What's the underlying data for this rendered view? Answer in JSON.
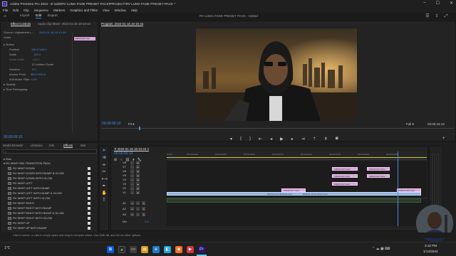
{
  "window": {
    "title": "Adobe Premiere Pro 2024 - E:\\utils\\RV LUMA FADE PRESET PACK\\PROJECT\\RV LUMA FADE PRESET PACK *",
    "app_icon": "Pr"
  },
  "menu": [
    "File",
    "Edit",
    "Clip",
    "Sequence",
    "Markers",
    "Graphics and Titles",
    "View",
    "Window",
    "Help"
  ],
  "workspace": {
    "tabs": [
      "Import",
      "Edit",
      "Export"
    ],
    "active_tab": "Edit",
    "center_title": "RV LUMA FADE PRESET PACK - Edited"
  },
  "effect_controls": {
    "tabs": [
      "Effect Controls",
      "Audio Clip Mixer: 2024-01-16 19-10-44"
    ],
    "source_label": "Source • Adjustment L...",
    "seq_label": "2024-01-16 19-10-44",
    "clip_chip": "Adjustment Lay",
    "section_video": "Video",
    "rows": [
      {
        "label": "Motion",
        "value": ""
      },
      {
        "label": "Position",
        "value": "960.0   540.0"
      },
      {
        "label": "Scale",
        "value": "100.0"
      },
      {
        "label": "Scale Width",
        "value": "100.0"
      },
      {
        "label": "",
        "value": "Uniform Scale"
      },
      {
        "label": "Rotation",
        "value": "0.0"
      },
      {
        "label": "Anchor Point",
        "value": "960.0   540.0"
      },
      {
        "label": "Anti-flicker Filter",
        "value": "0.00"
      },
      {
        "label": "Opacity",
        "value": ""
      },
      {
        "label": "Time Remapping",
        "value": ""
      }
    ],
    "timecode": "00:00:09:10"
  },
  "program": {
    "title": "Program: 2024-01-16 19-10-44",
    "timecode": "00:00:09:10",
    "fit": "Fit",
    "quality": "Full",
    "duration": "00:00:44:18"
  },
  "project": {
    "tabs": [
      "Media Browser",
      "Libraries",
      "Info",
      "Effects",
      "Mar"
    ],
    "active_tab": "Effects",
    "folders": [
      "Bins",
      "RV WHIP PAN TRANSITION PACK"
    ],
    "items": [
      "RV WHIP DOWN",
      "RV WHIP DOWN WITH BUMP & GLOW",
      "RV WHIP DOWN WITH GLOW",
      "RV WHIP LEFT",
      "RV WHIP LEFT WITH BUMP",
      "RV WHIP LEFT WITH BUMP & GLOW",
      "RV WHIP LEFT WITH GLOW",
      "RV WHIP RIGHT",
      "RV WHIP RIGHT WITH BUMP",
      "RV WHIP RIGHT WITH BUMP & GLOW",
      "RV WHIP RIGHT WITH GLOW",
      "RV WHIP UP",
      "RV WHIP UP WITH BUMP"
    ]
  },
  "timeline": {
    "timecode": "00:00:09:10",
    "ruler": [
      "00:00",
      "00:00:05:00",
      "00:00:10:00",
      "00:00:15:00",
      "00:00:20:00",
      "00:00:25:00",
      "00:00:30:00",
      "00:00:35:00",
      "00:00:40:00"
    ],
    "video_tracks": [
      "V8",
      "V7",
      "V6",
      "V5",
      "V4",
      "V3",
      "V2",
      "V1"
    ],
    "audio_tracks": [
      "A1",
      "A2",
      "A3"
    ],
    "mix_label": "Mix",
    "mix_value": "0.0",
    "clips": [
      {
        "label": "Adjustment Laye"
      },
      {
        "label": "Adjustment Laye"
      },
      {
        "label": "Adjustment Laye"
      },
      {
        "label": "Adjustment Laye"
      },
      {
        "label": "Adjustment Laye"
      },
      {
        "label": "Adjustment Laye"
      },
      {
        "label": "Adjustment Laye"
      }
    ],
    "v1_clip_label": "2024-01-16 19-10-44.mp4",
    "v1_clip_label2": "2024-01-16 19-10-44.mp4"
  },
  "status_bar": "Click to select, or click in empty space and drag to marquee select. Use Shift, Alt, and Ctrl for other options.",
  "taskbar": {
    "weather": "1°C",
    "time": "3:12 PM",
    "date": "1/14/2024",
    "search_icon": "search-icon"
  }
}
